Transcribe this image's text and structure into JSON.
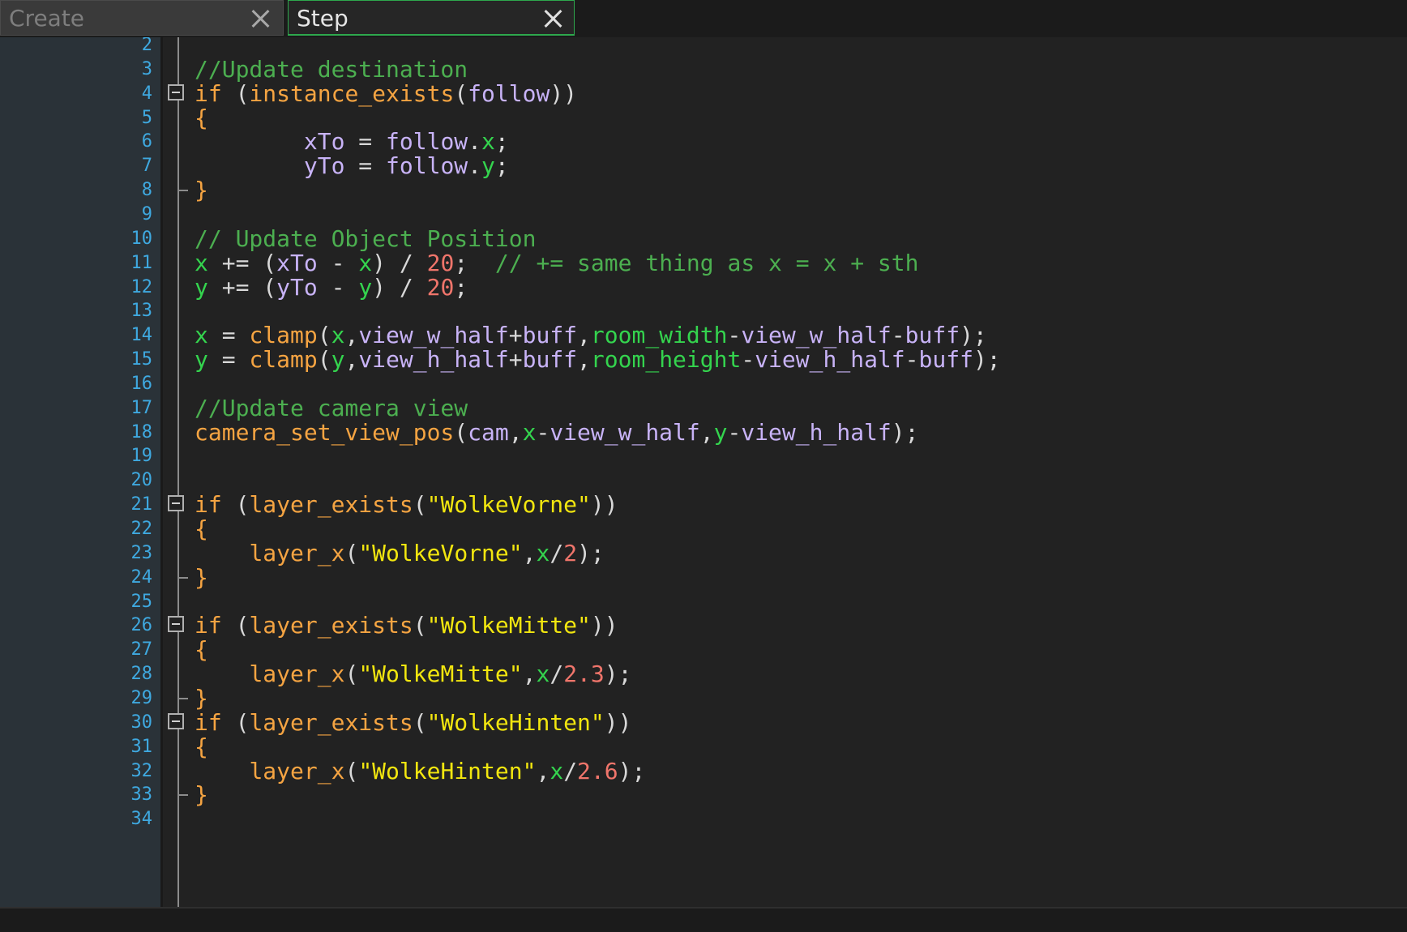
{
  "tabs": [
    {
      "label": "Create",
      "active": false
    },
    {
      "label": "Step",
      "active": true
    }
  ],
  "colors": {
    "comment": "#4caf50",
    "keyword": "#f5a442",
    "function": "#f5a442",
    "identifier": "#c8b3f7",
    "builtin": "#34d44e",
    "number": "#f0756b",
    "string": "#f2e60f",
    "operator": "#d8d8d8",
    "line_number": "#3fa9e0",
    "active_tab_border": "#2ea84d"
  },
  "lines": [
    {
      "n": "2",
      "tokens": []
    },
    {
      "n": "3",
      "tokens": [
        [
          "cm",
          "//Update destination"
        ]
      ]
    },
    {
      "n": "4",
      "fold": "start",
      "tokens": [
        [
          "kw",
          "if"
        ],
        [
          "op",
          " ("
        ],
        [
          "fn",
          "instance_exists"
        ],
        [
          "op",
          "("
        ],
        [
          "id",
          "follow"
        ],
        [
          "op",
          "))"
        ]
      ]
    },
    {
      "n": "5",
      "tokens": [
        [
          "kw",
          "{"
        ]
      ]
    },
    {
      "n": "6",
      "tokens": [
        [
          "op",
          "        "
        ],
        [
          "id",
          "xTo"
        ],
        [
          "op",
          " = "
        ],
        [
          "id",
          "follow"
        ],
        [
          "op",
          "."
        ],
        [
          "bi",
          "x"
        ],
        [
          "op",
          ";"
        ]
      ]
    },
    {
      "n": "7",
      "tokens": [
        [
          "op",
          "        "
        ],
        [
          "id",
          "yTo"
        ],
        [
          "op",
          " = "
        ],
        [
          "id",
          "follow"
        ],
        [
          "op",
          "."
        ],
        [
          "bi",
          "y"
        ],
        [
          "op",
          ";"
        ]
      ]
    },
    {
      "n": "8",
      "fold": "end",
      "tokens": [
        [
          "kw",
          "}"
        ]
      ]
    },
    {
      "n": "9",
      "tokens": []
    },
    {
      "n": "10",
      "tokens": [
        [
          "cm",
          "// Update Object Position"
        ]
      ]
    },
    {
      "n": "11",
      "tokens": [
        [
          "bi",
          "x"
        ],
        [
          "op",
          " += ("
        ],
        [
          "id",
          "xTo"
        ],
        [
          "op",
          " - "
        ],
        [
          "bi",
          "x"
        ],
        [
          "op",
          ") / "
        ],
        [
          "nm",
          "20"
        ],
        [
          "op",
          ";  "
        ],
        [
          "cm",
          "// += same thing as x = x + sth"
        ]
      ]
    },
    {
      "n": "12",
      "tokens": [
        [
          "bi",
          "y"
        ],
        [
          "op",
          " += ("
        ],
        [
          "id",
          "yTo"
        ],
        [
          "op",
          " - "
        ],
        [
          "bi",
          "y"
        ],
        [
          "op",
          ") / "
        ],
        [
          "nm",
          "20"
        ],
        [
          "op",
          ";"
        ]
      ]
    },
    {
      "n": "13",
      "tokens": []
    },
    {
      "n": "14",
      "tokens": [
        [
          "bi",
          "x"
        ],
        [
          "op",
          " = "
        ],
        [
          "fn",
          "clamp"
        ],
        [
          "op",
          "("
        ],
        [
          "bi",
          "x"
        ],
        [
          "op",
          ","
        ],
        [
          "id",
          "view_w_half"
        ],
        [
          "op",
          "+"
        ],
        [
          "id",
          "buff"
        ],
        [
          "op",
          ","
        ],
        [
          "bi",
          "room_width"
        ],
        [
          "op",
          "-"
        ],
        [
          "id",
          "view_w_half"
        ],
        [
          "op",
          "-"
        ],
        [
          "id",
          "buff"
        ],
        [
          "op",
          ");"
        ]
      ]
    },
    {
      "n": "15",
      "tokens": [
        [
          "bi",
          "y"
        ],
        [
          "op",
          " = "
        ],
        [
          "fn",
          "clamp"
        ],
        [
          "op",
          "("
        ],
        [
          "bi",
          "y"
        ],
        [
          "op",
          ","
        ],
        [
          "id",
          "view_h_half"
        ],
        [
          "op",
          "+"
        ],
        [
          "id",
          "buff"
        ],
        [
          "op",
          ","
        ],
        [
          "bi",
          "room_height"
        ],
        [
          "op",
          "-"
        ],
        [
          "id",
          "view_h_half"
        ],
        [
          "op",
          "-"
        ],
        [
          "id",
          "buff"
        ],
        [
          "op",
          ");"
        ]
      ]
    },
    {
      "n": "16",
      "tokens": []
    },
    {
      "n": "17",
      "tokens": [
        [
          "cm",
          "//Update camera view"
        ]
      ]
    },
    {
      "n": "18",
      "tokens": [
        [
          "fn",
          "camera_set_view_pos"
        ],
        [
          "op",
          "("
        ],
        [
          "id",
          "cam"
        ],
        [
          "op",
          ","
        ],
        [
          "bi",
          "x"
        ],
        [
          "op",
          "-"
        ],
        [
          "id",
          "view_w_half"
        ],
        [
          "op",
          ","
        ],
        [
          "bi",
          "y"
        ],
        [
          "op",
          "-"
        ],
        [
          "id",
          "view_h_half"
        ],
        [
          "op",
          ");"
        ]
      ]
    },
    {
      "n": "19",
      "tokens": []
    },
    {
      "n": "20",
      "tokens": []
    },
    {
      "n": "21",
      "fold": "start",
      "tokens": [
        [
          "kw",
          "if"
        ],
        [
          "op",
          " ("
        ],
        [
          "fn",
          "layer_exists"
        ],
        [
          "op",
          "("
        ],
        [
          "st",
          "\"WolkeVorne\""
        ],
        [
          "op",
          "))"
        ]
      ]
    },
    {
      "n": "22",
      "tokens": [
        [
          "kw",
          "{"
        ]
      ]
    },
    {
      "n": "23",
      "tokens": [
        [
          "op",
          "    "
        ],
        [
          "fn",
          "layer_x"
        ],
        [
          "op",
          "("
        ],
        [
          "st",
          "\"WolkeVorne\""
        ],
        [
          "op",
          ","
        ],
        [
          "bi",
          "x"
        ],
        [
          "op",
          "/"
        ],
        [
          "nm",
          "2"
        ],
        [
          "op",
          ");"
        ]
      ]
    },
    {
      "n": "24",
      "fold": "end",
      "tokens": [
        [
          "kw",
          "}"
        ]
      ]
    },
    {
      "n": "25",
      "tokens": []
    },
    {
      "n": "26",
      "fold": "start",
      "tokens": [
        [
          "kw",
          "if"
        ],
        [
          "op",
          " ("
        ],
        [
          "fn",
          "layer_exists"
        ],
        [
          "op",
          "("
        ],
        [
          "st",
          "\"WolkeMitte\""
        ],
        [
          "op",
          "))"
        ]
      ]
    },
    {
      "n": "27",
      "tokens": [
        [
          "kw",
          "{"
        ]
      ]
    },
    {
      "n": "28",
      "tokens": [
        [
          "op",
          "    "
        ],
        [
          "fn",
          "layer_x"
        ],
        [
          "op",
          "("
        ],
        [
          "st",
          "\"WolkeMitte\""
        ],
        [
          "op",
          ","
        ],
        [
          "bi",
          "x"
        ],
        [
          "op",
          "/"
        ],
        [
          "nm",
          "2.3"
        ],
        [
          "op",
          ");"
        ]
      ]
    },
    {
      "n": "29",
      "fold": "end",
      "tokens": [
        [
          "kw",
          "}"
        ]
      ]
    },
    {
      "n": "30",
      "fold": "start",
      "tokens": [
        [
          "kw",
          "if"
        ],
        [
          "op",
          " ("
        ],
        [
          "fn",
          "layer_exists"
        ],
        [
          "op",
          "("
        ],
        [
          "st",
          "\"WolkeHinten\""
        ],
        [
          "op",
          "))"
        ]
      ]
    },
    {
      "n": "31",
      "tokens": [
        [
          "kw",
          "{"
        ]
      ]
    },
    {
      "n": "32",
      "tokens": [
        [
          "op",
          "    "
        ],
        [
          "fn",
          "layer_x"
        ],
        [
          "op",
          "("
        ],
        [
          "st",
          "\"WolkeHinten\""
        ],
        [
          "op",
          ","
        ],
        [
          "bi",
          "x"
        ],
        [
          "op",
          "/"
        ],
        [
          "nm",
          "2.6"
        ],
        [
          "op",
          ");"
        ]
      ]
    },
    {
      "n": "33",
      "fold": "end",
      "tokens": [
        [
          "kw",
          "}"
        ]
      ]
    },
    {
      "n": "34",
      "tokens": []
    }
  ]
}
